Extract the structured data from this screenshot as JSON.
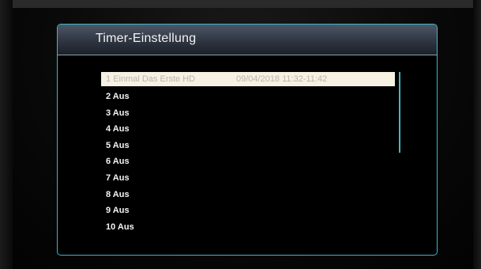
{
  "header": {
    "title": "Timer-Einstellung"
  },
  "timers": [
    {
      "index": "1",
      "label": "Einmal Das Erste HD",
      "time": "09/04/2018 11:32-11:42"
    },
    {
      "index": "2",
      "label": "Aus",
      "time": ""
    },
    {
      "index": "3",
      "label": "Aus",
      "time": ""
    },
    {
      "index": "4",
      "label": "Aus",
      "time": ""
    },
    {
      "index": "5",
      "label": "Aus",
      "time": ""
    },
    {
      "index": "6",
      "label": "Aus",
      "time": ""
    },
    {
      "index": "7",
      "label": "Aus",
      "time": ""
    },
    {
      "index": "8",
      "label": "Aus",
      "time": ""
    },
    {
      "index": "9",
      "label": "Aus",
      "time": ""
    },
    {
      "index": "10",
      "label": "Aus",
      "time": ""
    }
  ],
  "colors": {
    "accent": "#3fb8c8",
    "selection": "#f7f1e4"
  }
}
